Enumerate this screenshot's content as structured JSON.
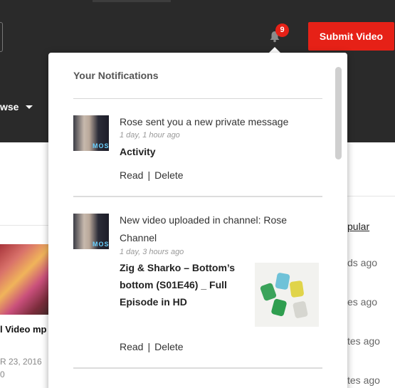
{
  "header": {
    "submit_label": "Submit Video",
    "notification_count": "9",
    "browse_label": "wse",
    "accent_color": "#e62117"
  },
  "background": {
    "video_title": "l Video mp",
    "date": "R 23, 2016",
    "zero": "0",
    "popular": "pular",
    "ago_1": "ds ago",
    "ago_2": "es ago",
    "ago_3": "tes ago",
    "ago_4": "tes ago"
  },
  "notifications": {
    "title": "Your Notifications",
    "items": [
      {
        "message": "Rose sent you a new private message",
        "time": "1 day, 1 hour ago",
        "detail": "Activity",
        "read_label": "Read",
        "delete_label": "Delete",
        "avatar_tag": "MOS"
      },
      {
        "message_line1": "New video uploaded in channel: Rose",
        "message_line2": "Channel",
        "time": "1 day, 3 hours ago",
        "detail_line1": "Zig & Sharko – Bottom’s",
        "detail_line2": "bottom (S01E46) _ Full",
        "detail_line3": "Episode in HD",
        "read_label": "Read",
        "delete_label": "Delete",
        "avatar_tag": "MOS"
      }
    ]
  }
}
